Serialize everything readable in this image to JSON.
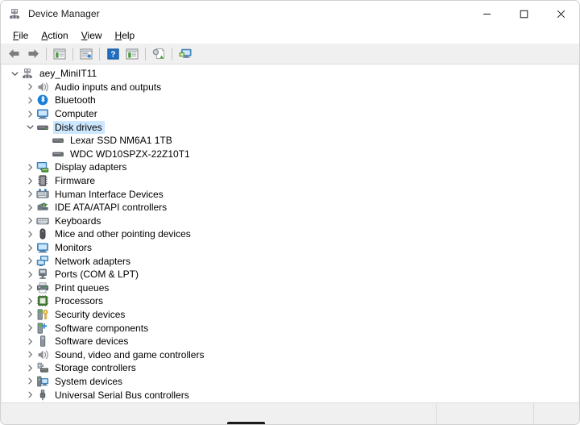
{
  "window": {
    "title": "Device Manager",
    "app_icon": "device-manager-icon",
    "controls": [
      {
        "name": "minimize-button",
        "glyph": "minimize"
      },
      {
        "name": "maximize-button",
        "glyph": "maximize"
      },
      {
        "name": "close-button",
        "glyph": "close"
      }
    ]
  },
  "menubar": {
    "items": [
      {
        "name": "menu-file",
        "accel": "F",
        "rest": "ile"
      },
      {
        "name": "menu-action",
        "accel": "A",
        "rest": "ction"
      },
      {
        "name": "menu-view",
        "accel": "V",
        "rest": "iew"
      },
      {
        "name": "menu-help",
        "accel": "H",
        "rest": "elp"
      }
    ]
  },
  "toolbar": {
    "buttons": [
      {
        "name": "back-button",
        "icon": "back-arrow-icon",
        "tooltip": "Back"
      },
      {
        "name": "forward-button",
        "icon": "forward-arrow-icon",
        "tooltip": "Forward"
      },
      {
        "name": "show-hide-tree-button",
        "icon": "tree-pane-icon",
        "tooltip": "Show/Hide console tree"
      },
      {
        "name": "properties-button",
        "icon": "properties-icon",
        "tooltip": "Properties"
      },
      {
        "name": "help-button",
        "icon": "help-question-icon",
        "tooltip": "Help"
      },
      {
        "name": "details-view-button",
        "icon": "details-pane-icon",
        "tooltip": "View"
      },
      {
        "name": "update-driver-button",
        "icon": "update-driver-icon",
        "tooltip": "Update driver"
      },
      {
        "name": "scan-hardware-button",
        "icon": "scan-hardware-icon",
        "tooltip": "Scan for hardware changes"
      }
    ]
  },
  "tree": {
    "root": {
      "label": "aey_MiniIT11",
      "icon": "computer-node-icon",
      "expanded": true,
      "indent": 0,
      "twisty": "expanded",
      "selected": false
    },
    "nodes": [
      {
        "label": "Audio inputs and outputs",
        "icon": "speaker-icon",
        "twisty": "collapsed",
        "indent": 1,
        "selected": false
      },
      {
        "label": "Bluetooth",
        "icon": "bluetooth-icon",
        "twisty": "collapsed",
        "indent": 1,
        "selected": false
      },
      {
        "label": "Computer",
        "icon": "computer-icon",
        "twisty": "collapsed",
        "indent": 1,
        "selected": false
      },
      {
        "label": "Disk drives",
        "icon": "disk-drive-icon",
        "twisty": "expanded",
        "indent": 1,
        "selected": true
      },
      {
        "label": "Lexar SSD NM6A1 1TB",
        "icon": "disk-drive-icon",
        "twisty": "none",
        "indent": 2,
        "selected": false
      },
      {
        "label": "WDC WD10SPZX-22Z10T1",
        "icon": "disk-drive-icon",
        "twisty": "none",
        "indent": 2,
        "selected": false
      },
      {
        "label": "Display adapters",
        "icon": "display-adapter-icon",
        "twisty": "collapsed",
        "indent": 1,
        "selected": false
      },
      {
        "label": "Firmware",
        "icon": "firmware-chip-icon",
        "twisty": "collapsed",
        "indent": 1,
        "selected": false
      },
      {
        "label": "Human Interface Devices",
        "icon": "hid-icon",
        "twisty": "collapsed",
        "indent": 1,
        "selected": false
      },
      {
        "label": "IDE ATA/ATAPI controllers",
        "icon": "ide-controller-icon",
        "twisty": "collapsed",
        "indent": 1,
        "selected": false
      },
      {
        "label": "Keyboards",
        "icon": "keyboard-icon",
        "twisty": "collapsed",
        "indent": 1,
        "selected": false
      },
      {
        "label": "Mice and other pointing devices",
        "icon": "mouse-icon",
        "twisty": "collapsed",
        "indent": 1,
        "selected": false
      },
      {
        "label": "Monitors",
        "icon": "monitor-icon",
        "twisty": "collapsed",
        "indent": 1,
        "selected": false
      },
      {
        "label": "Network adapters",
        "icon": "network-adapter-icon",
        "twisty": "collapsed",
        "indent": 1,
        "selected": false
      },
      {
        "label": "Ports (COM & LPT)",
        "icon": "port-icon",
        "twisty": "collapsed",
        "indent": 1,
        "selected": false
      },
      {
        "label": "Print queues",
        "icon": "printer-icon",
        "twisty": "collapsed",
        "indent": 1,
        "selected": false
      },
      {
        "label": "Processors",
        "icon": "processor-icon",
        "twisty": "collapsed",
        "indent": 1,
        "selected": false
      },
      {
        "label": "Security devices",
        "icon": "security-device-icon",
        "twisty": "collapsed",
        "indent": 1,
        "selected": false
      },
      {
        "label": "Software components",
        "icon": "software-component-icon",
        "twisty": "collapsed",
        "indent": 1,
        "selected": false
      },
      {
        "label": "Software devices",
        "icon": "software-device-icon",
        "twisty": "collapsed",
        "indent": 1,
        "selected": false
      },
      {
        "label": "Sound, video and game controllers",
        "icon": "speaker-icon",
        "twisty": "collapsed",
        "indent": 1,
        "selected": false
      },
      {
        "label": "Storage controllers",
        "icon": "storage-controller-icon",
        "twisty": "collapsed",
        "indent": 1,
        "selected": false
      },
      {
        "label": "System devices",
        "icon": "system-device-icon",
        "twisty": "collapsed",
        "indent": 1,
        "selected": false
      },
      {
        "label": "Universal Serial Bus controllers",
        "icon": "usb-icon",
        "twisty": "collapsed",
        "indent": 1,
        "selected": false
      }
    ]
  },
  "statusbar": {
    "main_text": "",
    "pane2_text": "",
    "pane3_text": ""
  },
  "colors": {
    "selection": "#cce8ff",
    "toolbar_bg": "#f0f0f0",
    "statusbar_bg": "#f0f0f0",
    "text": "#000000",
    "twisty": "#6d6d6d"
  }
}
